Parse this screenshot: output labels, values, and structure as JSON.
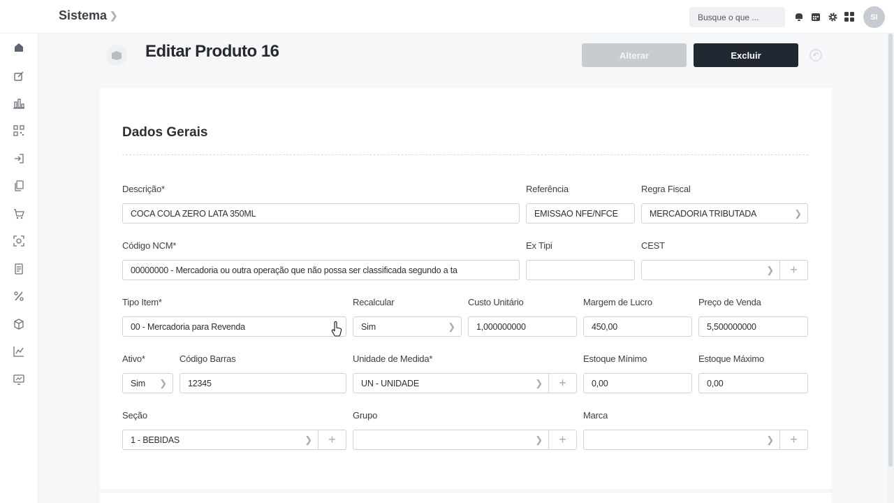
{
  "app": {
    "title": "Sistema"
  },
  "search": {
    "placeholder": "Busque o que ..."
  },
  "user": {
    "initials": "SI"
  },
  "page": {
    "title": "Editar Produto 16",
    "alterar_label": "Alterar",
    "excluir_label": "Excluir"
  },
  "section": {
    "title": "Dados Gerais"
  },
  "fields": {
    "descricao": {
      "label": "Descrição*",
      "value": "COCA COLA ZERO LATA 350ML"
    },
    "referencia": {
      "label": "Referência",
      "value": "EMISSAO NFE/NFCE"
    },
    "regra_fiscal": {
      "label": "Regra Fiscal",
      "value": "MERCADORIA TRIBUTADA"
    },
    "codigo_ncm": {
      "label": "Código NCM*",
      "value": "00000000 - Mercadoria ou outra operação que não possa ser classificada segundo a ta"
    },
    "ex_tipi": {
      "label": "Ex Tipi",
      "value": ""
    },
    "cest": {
      "label": "CEST",
      "value": ""
    },
    "tipo_item": {
      "label": "Tipo Item*",
      "value": "00 - Mercadoria para Revenda"
    },
    "recalcular": {
      "label": "Recalcular",
      "value": "Sim"
    },
    "custo_unitario": {
      "label": "Custo Unitário",
      "value": "1,000000000"
    },
    "margem_lucro": {
      "label": "Margem de Lucro",
      "value": "450,00"
    },
    "preco_venda": {
      "label": "Preço de Venda",
      "value": "5,500000000"
    },
    "ativo": {
      "label": "Ativo*",
      "value": "Sim"
    },
    "codigo_barras": {
      "label": "Código Barras",
      "value": "12345"
    },
    "unidade_medida": {
      "label": "Unidade de Medida*",
      "value": "UN - UNIDADE"
    },
    "estoque_minimo": {
      "label": "Estoque Mínimo",
      "value": "0,00"
    },
    "estoque_maximo": {
      "label": "Estoque Máximo",
      "value": "0,00"
    },
    "secao": {
      "label": "Seção",
      "value": "1 - BEBIDAS"
    },
    "grupo": {
      "label": "Grupo",
      "value": ""
    },
    "marca": {
      "label": "Marca",
      "value": ""
    }
  },
  "sidebar": {
    "icons": [
      "home-icon",
      "edit-icon",
      "chart-bar-icon",
      "qr-code-icon",
      "login-icon",
      "copy-icon",
      "cart-icon",
      "scan-icon",
      "document-icon",
      "percent-icon",
      "box-icon",
      "chart-line-icon",
      "monitor-chart-icon"
    ]
  },
  "colors": {
    "primary_button": "#222831",
    "disabled_button": "#c9cccf"
  }
}
